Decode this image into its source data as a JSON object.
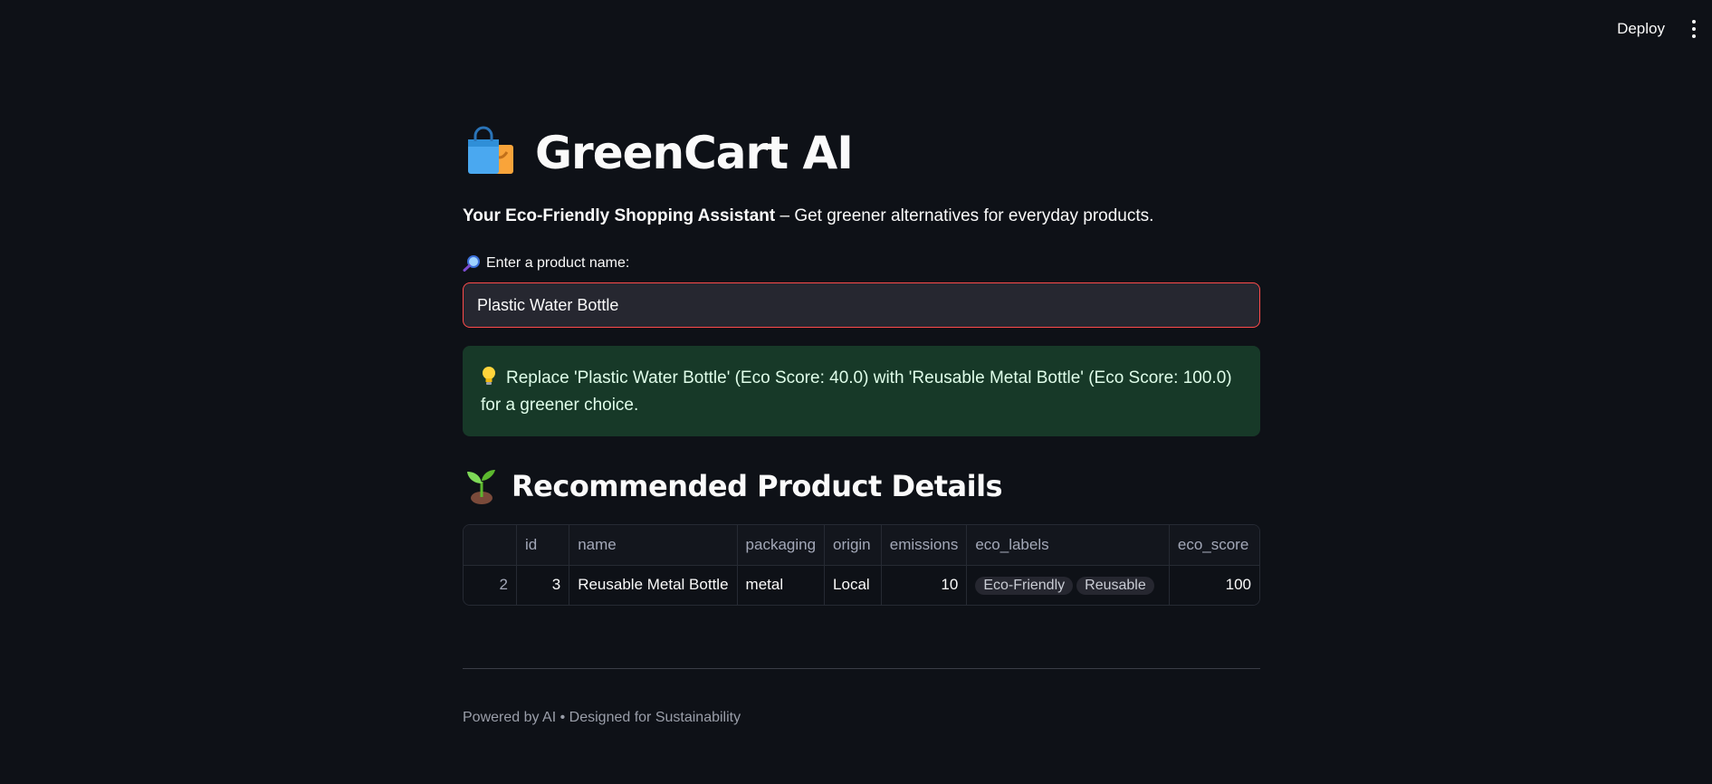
{
  "toolbar": {
    "deploy_label": "Deploy"
  },
  "header": {
    "title": "GreenCart AI",
    "title_icon": "shopping-bags-icon",
    "subtitle_bold": "Your Eco-Friendly Shopping Assistant",
    "subtitle_rest": " – Get greener alternatives for everyday products."
  },
  "search": {
    "label": "Enter a product name:",
    "label_icon": "magnifying-glass-icon",
    "value": "Plastic Water Bottle"
  },
  "alert": {
    "icon": "lightbulb-icon",
    "message": "Replace 'Plastic Water Bottle' (Eco Score: 40.0) with 'Reusable Metal Bottle' (Eco Score: 100.0) for a greener choice."
  },
  "section": {
    "title": "Recommended Product Details",
    "icon": "seedling-icon"
  },
  "table": {
    "columns": [
      "",
      "id",
      "name",
      "packaging",
      "origin",
      "emissions",
      "eco_labels",
      "eco_score"
    ],
    "rows": [
      {
        "index": "2",
        "id": "3",
        "name": "Reusable Metal Bottle",
        "packaging": "metal",
        "origin": "Local",
        "emissions": "10",
        "eco_labels": [
          "Eco-Friendly",
          "Reusable"
        ],
        "eco_score": "100"
      }
    ]
  },
  "footer": {
    "text": "Powered by AI • Designed for Sustainability"
  },
  "colors": {
    "background": "#0e1117",
    "input_border": "#ff4b4b",
    "success_bg": "#173928",
    "success_text": "#dffde9"
  }
}
